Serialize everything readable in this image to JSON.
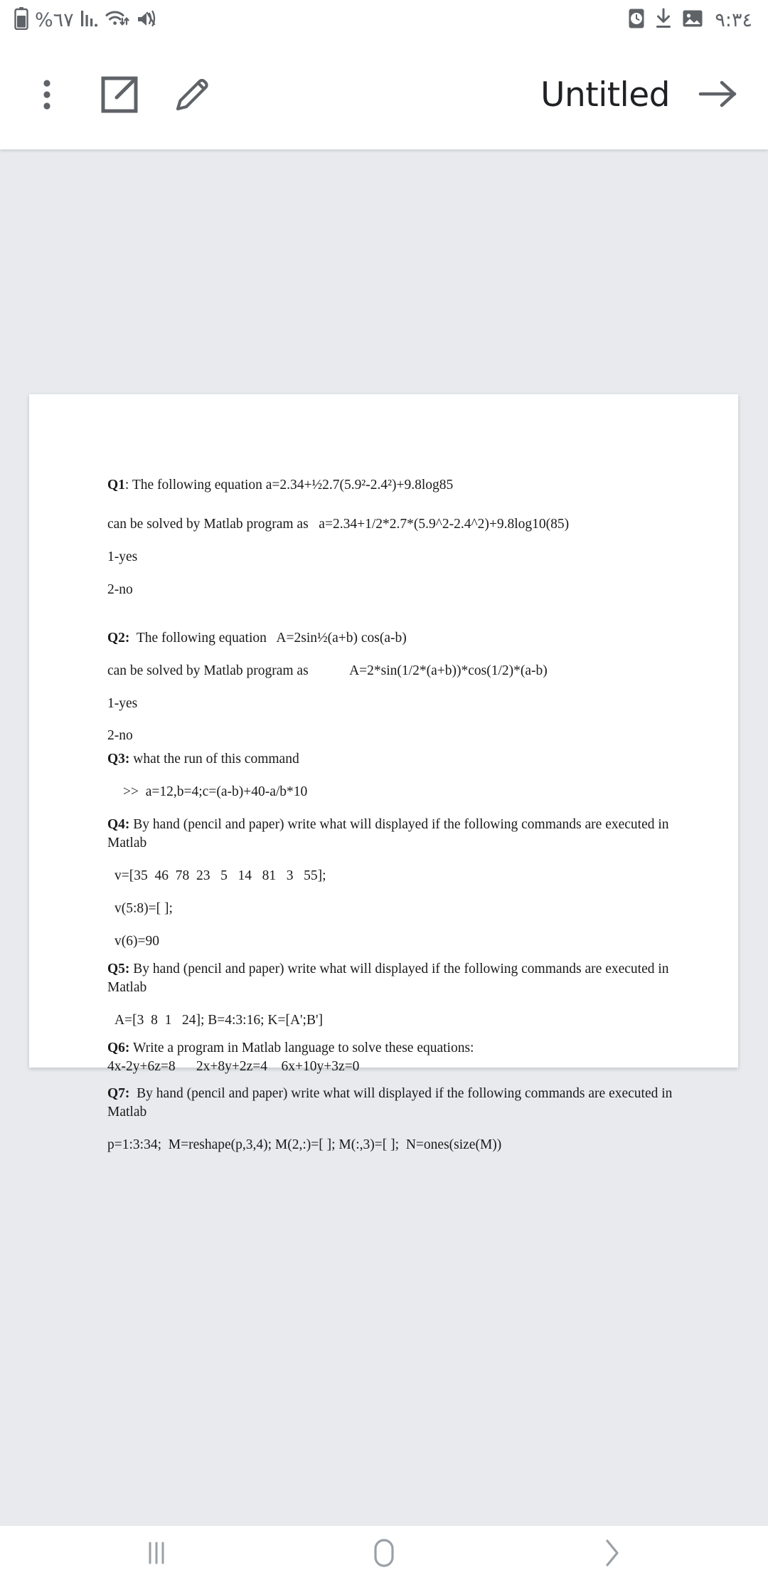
{
  "status_bar": {
    "battery_percent_text": "%٦٧",
    "clock_text": "٩:٣٤",
    "left_icons": [
      "battery-icon",
      "signal-bars-icon",
      "wifi-icon",
      "vibrate-mode-icon"
    ],
    "right_icons": [
      "alarm-clock-icon",
      "download-icon",
      "image-icon"
    ],
    "icon_color": "#5f6368"
  },
  "toolbar": {
    "title": "Untitled",
    "overflow_label": "more-options",
    "open_external_label": "open-in-new",
    "edit_label": "edit",
    "forward_label": "forward",
    "background": "#ffffff",
    "title_color": "#202124"
  },
  "viewer": {
    "background": "#e8eaed",
    "page_background": "#ffffff"
  },
  "document": {
    "lines": [
      {
        "id": "q1-title",
        "html": "<b>Q1</b>: The following equation a=2.34+½2.7(5.9²-2.4²)+9.8log85"
      },
      {
        "id": "q1-solution",
        "html": "can be solved by Matlab program as   a=2.34+1/2*2.7*(5.9^2-2.4^2)+9.8log10(85)"
      },
      {
        "id": "q1-option-1",
        "html": "1-yes"
      },
      {
        "id": "q1-option-2",
        "html": "2-no"
      },
      {
        "id": "q2-title",
        "html": "<b>Q2:</b>  The following equation   A=2sin½(a+b) cos(a-b)"
      },
      {
        "id": "q2-solution",
        "html": "can be solved by Matlab program as            A=2*sin(1/2*(a+b))*cos(1/2)*(a-b)"
      },
      {
        "id": "q2-option-1",
        "html": "1-yes"
      },
      {
        "id": "q2-option-2",
        "html": "2-no"
      },
      {
        "id": "q3-title",
        "html": "<b>Q3:</b> what the run of this command"
      },
      {
        "id": "q3-command",
        "html": "&gt;&gt;  a=12,b=4;c=(a-b)+40-a/b*10"
      },
      {
        "id": "q4-title",
        "html": "<b>Q4:</b> By hand (pencil and paper) write what will displayed if the following commands are executed in Matlab"
      },
      {
        "id": "q4-command-1",
        "html": "v=[35  46  78  23   5   14   81   3   55];"
      },
      {
        "id": "q4-command-2",
        "html": "v(5:8)=[ ];"
      },
      {
        "id": "q4-command-3",
        "html": "v(6)=90"
      },
      {
        "id": "q5-title",
        "html": "<b>Q5:</b> By hand (pencil and paper) write what will displayed if the following commands are executed in Matlab"
      },
      {
        "id": "q5-command",
        "html": "A=[3  8  1   24]; B=4:3:16; K=[A';B']"
      },
      {
        "id": "q6-title",
        "html": "<b>Q6:</b> Write a program in Matlab language to solve these equations:"
      },
      {
        "id": "q6-equations",
        "html": "4x-2y+6z=8      2x+8y+2z=4    6x+10y+3z=0"
      },
      {
        "id": "q7-title",
        "html": "<b>Q7:</b>  By hand (pencil and paper) write what will displayed if the following commands are executed in Matlab"
      },
      {
        "id": "q7-command",
        "html": "p=1:3:34;  M=reshape(p,3,4); M(2,:)=[ ]; M(:,3)=[ ];  N=ones(size(M))"
      }
    ]
  },
  "nav_bar": {
    "recents_label": "recent-apps",
    "home_label": "home",
    "back_label": "back",
    "icon_color": "#9aa0a6",
    "background": "#ffffff"
  }
}
